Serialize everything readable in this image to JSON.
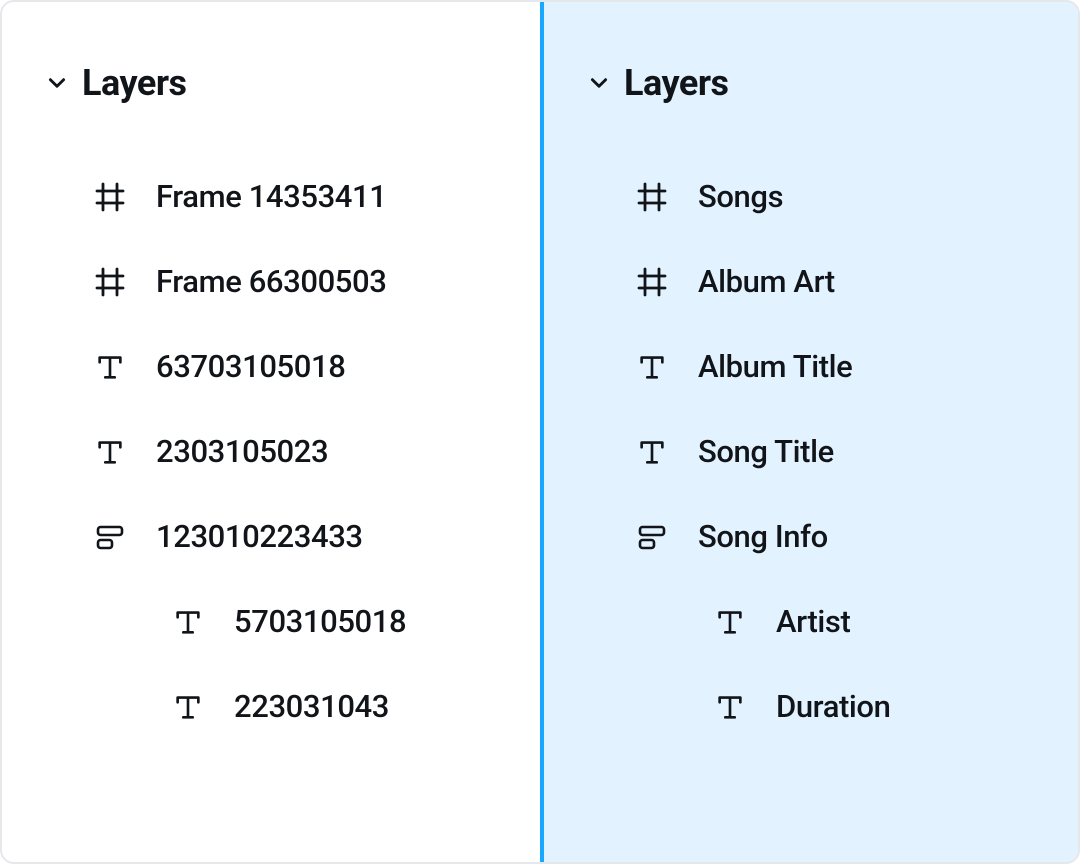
{
  "left": {
    "title": "Layers",
    "items": [
      {
        "type": "frame",
        "label": "Frame 14353411"
      },
      {
        "type": "frame",
        "label": "Frame 66300503"
      },
      {
        "type": "text",
        "label": "63703105018"
      },
      {
        "type": "text",
        "label": "2303105023"
      },
      {
        "type": "component",
        "label": "123010223433"
      },
      {
        "type": "text",
        "label": "5703105018",
        "indent": 1
      },
      {
        "type": "text",
        "label": "223031043",
        "indent": 1
      }
    ]
  },
  "right": {
    "title": "Layers",
    "items": [
      {
        "type": "frame",
        "label": "Songs"
      },
      {
        "type": "frame",
        "label": "Album Art"
      },
      {
        "type": "text",
        "label": "Album Title"
      },
      {
        "type": "text",
        "label": "Song Title"
      },
      {
        "type": "component",
        "label": "Song Info"
      },
      {
        "type": "text",
        "label": "Artist",
        "indent": 1
      },
      {
        "type": "text",
        "label": "Duration",
        "indent": 1
      }
    ]
  }
}
